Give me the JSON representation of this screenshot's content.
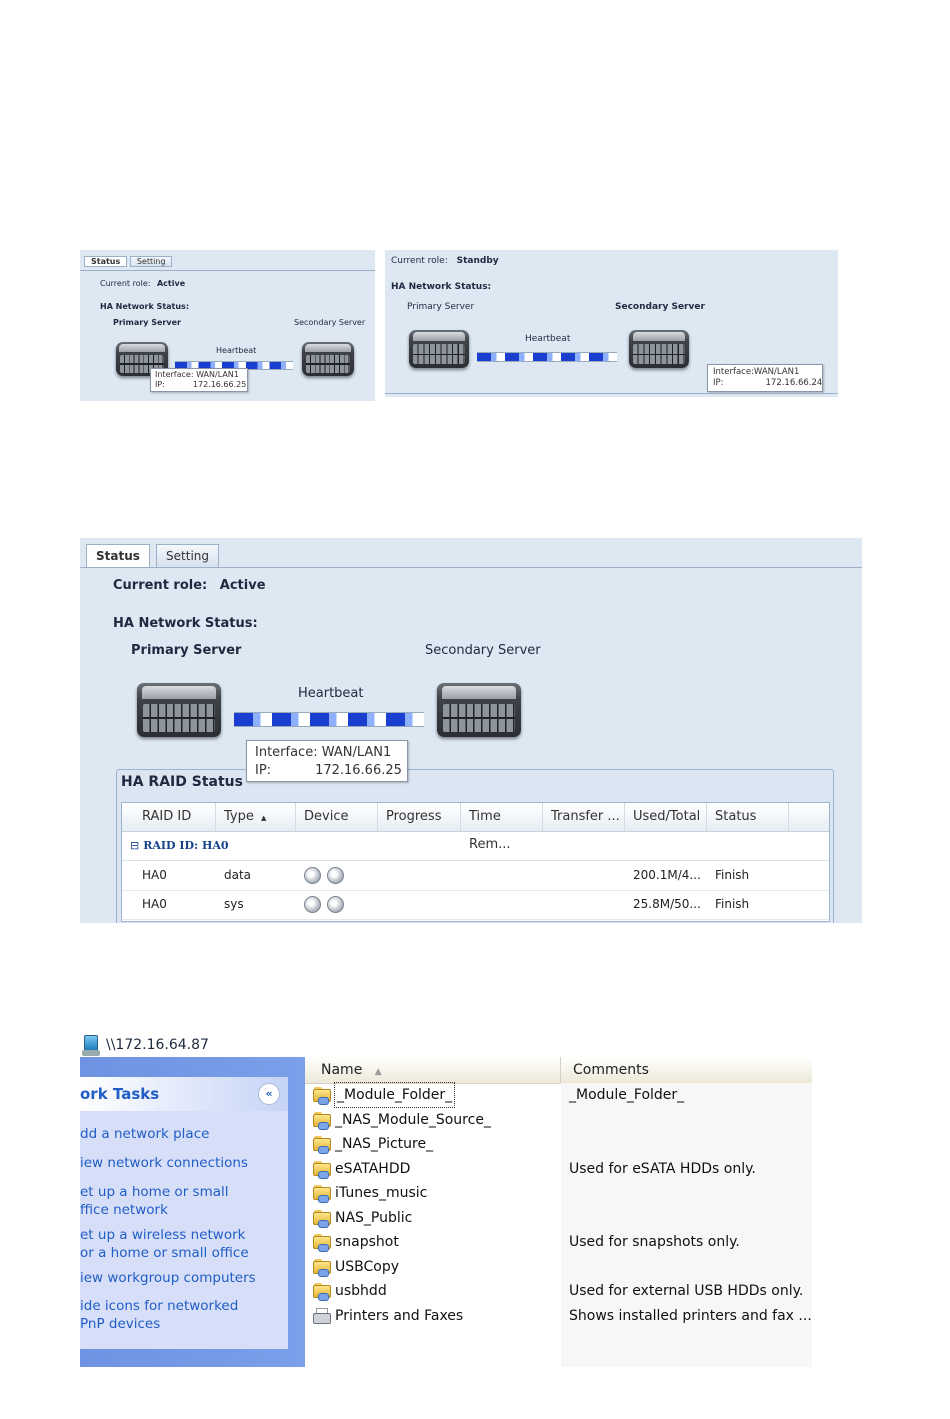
{
  "panel_small_active": {
    "tabs": [
      "Status",
      "Setting"
    ],
    "role_label": "Current role:",
    "role_value": "Active",
    "ha_network_label": "HA Network Status:",
    "primary_label": "Primary Server",
    "secondary_label": "Secondary Server",
    "heartbeat_label": "Heartbeat",
    "tooltip": {
      "interface_label": "Interface:",
      "interface_value": "WAN/LAN1",
      "ip_label": "IP:",
      "ip_value": "172.16.66.25"
    }
  },
  "panel_small_standby": {
    "role_label": "Current role:",
    "role_value": "Standby",
    "ha_network_label": "HA Network Status:",
    "primary_label": "Primary Server",
    "secondary_label": "Secondary Server",
    "heartbeat_label": "Heartbeat",
    "tooltip": {
      "interface_label": "Interface:",
      "interface_value": "WAN/LAN1",
      "ip_label": "IP:",
      "ip_value": "172.16.66.24"
    }
  },
  "panel_large": {
    "tabs": {
      "status": "Status",
      "setting": "Setting"
    },
    "role_label": "Current role:",
    "role_value": "Active",
    "ha_network_label": "HA Network Status:",
    "primary_label": "Primary Server",
    "secondary_label": "Secondary Server",
    "heartbeat_label": "Heartbeat",
    "tooltip": {
      "interface_label": "Interface:",
      "interface_value": "WAN/LAN1",
      "ip_label": "IP:",
      "ip_value": "172.16.66.25"
    },
    "raid": {
      "title": "HA RAID Status",
      "columns": [
        "RAID ID",
        "Type",
        "Device",
        "Progress",
        "Time Rem...",
        "Transfer ...",
        "Used/Total",
        "Status"
      ],
      "sort_indicator": "▲",
      "group_label": "RAID ID: HA0",
      "rows": [
        {
          "raid_id": "HA0",
          "type": "data",
          "used_total": "200.1M/4...",
          "status": "Finish"
        },
        {
          "raid_id": "HA0",
          "type": "sys",
          "used_total": "25.8M/50...",
          "status": "Finish"
        }
      ]
    }
  },
  "explorer": {
    "address": "\\\\172.16.64.87",
    "task_title": "ork Tasks",
    "collapse_glyph": "«",
    "tasks": [
      [
        "dd a network place"
      ],
      [
        "iew network connections"
      ],
      [
        "et up a home or small",
        "ffice network"
      ],
      [
        "et up a wireless network",
        "or a home or small office"
      ],
      [
        "iew workgroup computers"
      ],
      [
        "ide icons for networked",
        "PnP devices"
      ]
    ],
    "columns": {
      "name": "Name",
      "comments": "Comments",
      "sort_indicator": "▲"
    },
    "items": [
      {
        "name": "_Module_Folder_",
        "comment": "_Module_Folder_",
        "icon": "shared-folder-icon"
      },
      {
        "name": "_NAS_Module_Source_",
        "comment": "",
        "icon": "shared-folder-icon"
      },
      {
        "name": "_NAS_Picture_",
        "comment": "",
        "icon": "shared-folder-icon"
      },
      {
        "name": "eSATAHDD",
        "comment": "Used for eSATA HDDs only.",
        "icon": "shared-folder-icon"
      },
      {
        "name": "iTunes_music",
        "comment": "",
        "icon": "shared-folder-icon"
      },
      {
        "name": "NAS_Public",
        "comment": "",
        "icon": "shared-folder-icon"
      },
      {
        "name": "snapshot",
        "comment": "Used for snapshots only.",
        "icon": "shared-folder-icon"
      },
      {
        "name": "USBCopy",
        "comment": "",
        "icon": "shared-folder-icon"
      },
      {
        "name": "usbhdd",
        "comment": "Used for external USB HDDs only.",
        "icon": "shared-folder-icon"
      },
      {
        "name": "Printers and Faxes",
        "comment": "Shows installed printers and fax ...",
        "icon": "printer-icon"
      }
    ]
  }
}
